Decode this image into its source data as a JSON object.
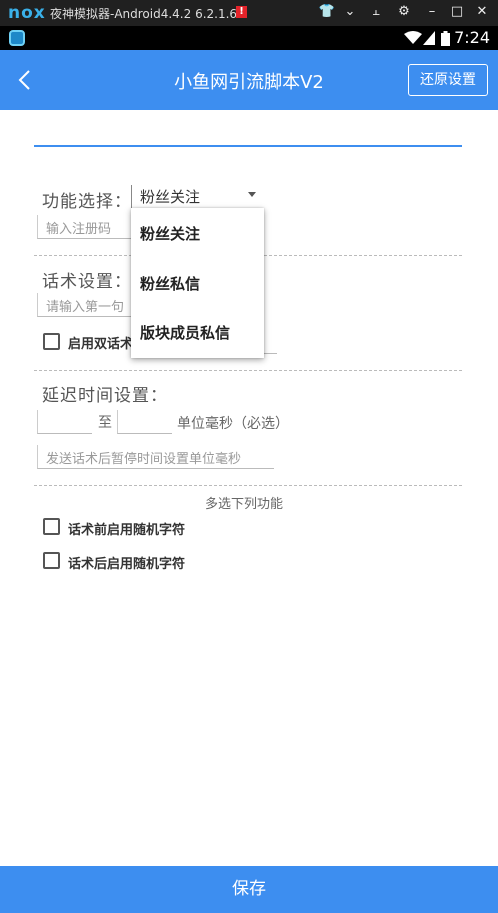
{
  "emulator": {
    "logo": "nox",
    "title": "夜神模拟器-Android4.4.2 6.2.1.6",
    "warn": "!",
    "controls": [
      "shirt-icon",
      "chevron-down-icon",
      "pin-icon",
      "gear-icon",
      "minimize-icon",
      "maximize-icon",
      "close-icon"
    ]
  },
  "status": {
    "time": "7:24"
  },
  "appbar": {
    "title": "小鱼网引流脚本V2",
    "reset_label": "还原设置"
  },
  "form": {
    "function_label": "功能选择：",
    "function_selected": "粉丝关注",
    "reg_code_placeholder": "输入注册码",
    "speech_label": "话术设置：",
    "speech_placeholder": "请输入第一句",
    "dual_speech_label": "启用双话术",
    "delay_label": "延迟时间设置：",
    "to_label": "至",
    "unit_label": "单位毫秒（必选）",
    "pause_placeholder": "发送话术后暂停时间设置单位毫秒",
    "multi_label": "多选下列功能",
    "random_before_label": "话术前启用随机字符",
    "random_after_label": "话术后启用随机字符"
  },
  "dropdown": {
    "options": [
      "粉丝关注",
      "粉丝私信",
      "版块成员私信"
    ]
  },
  "save_label": "保存",
  "colors": {
    "primary": "#3d8ef0",
    "emulator_bar": "#202020"
  }
}
